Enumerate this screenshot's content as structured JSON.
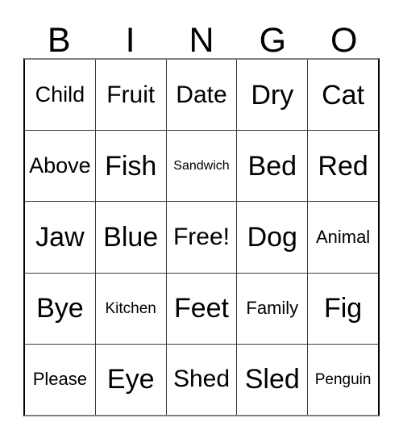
{
  "card": {
    "header": {
      "letters": [
        "B",
        "I",
        "N",
        "G",
        "O"
      ]
    },
    "grid": {
      "rows": 5,
      "columns": 5,
      "cells": [
        [
          {
            "label": "Child",
            "size": "md"
          },
          {
            "label": "Fruit",
            "size": "lg"
          },
          {
            "label": "Date",
            "size": "lg"
          },
          {
            "label": "Dry",
            "size": "xl"
          },
          {
            "label": "Cat",
            "size": "xl"
          }
        ],
        [
          {
            "label": "Above",
            "size": "md"
          },
          {
            "label": "Fish",
            "size": "xl"
          },
          {
            "label": "Sandwich",
            "size": "xxs"
          },
          {
            "label": "Bed",
            "size": "xl"
          },
          {
            "label": "Red",
            "size": "xl"
          }
        ],
        [
          {
            "label": "Jaw",
            "size": "xl"
          },
          {
            "label": "Blue",
            "size": "xl"
          },
          {
            "label": "Free!",
            "size": "lg"
          },
          {
            "label": "Dog",
            "size": "xl"
          },
          {
            "label": "Animal",
            "size": "sm"
          }
        ],
        [
          {
            "label": "Bye",
            "size": "xl"
          },
          {
            "label": "Kitchen",
            "size": "xs"
          },
          {
            "label": "Feet",
            "size": "xl"
          },
          {
            "label": "Family",
            "size": "sm"
          },
          {
            "label": "Fig",
            "size": "xl"
          }
        ],
        [
          {
            "label": "Please",
            "size": "sm"
          },
          {
            "label": "Eye",
            "size": "xl"
          },
          {
            "label": "Shed",
            "size": "lg"
          },
          {
            "label": "Sled",
            "size": "xl"
          },
          {
            "label": "Penguin",
            "size": "xs"
          }
        ]
      ]
    },
    "colors": {
      "grid_line": "#3a3a3a",
      "outer_border_dark": "#000000",
      "outer_border_light": "#808080",
      "text": "#000000",
      "background": "#ffffff"
    }
  }
}
